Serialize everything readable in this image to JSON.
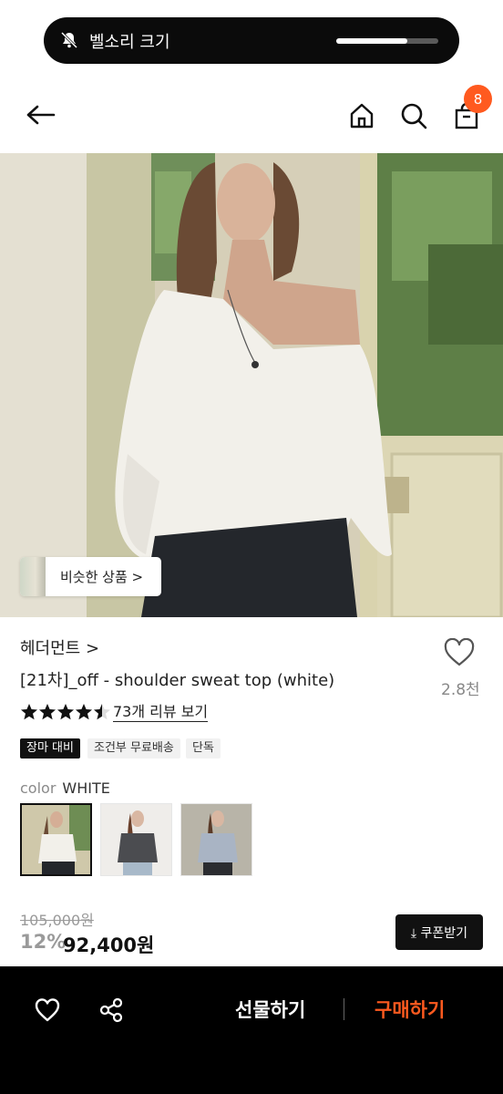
{
  "volume_toast": {
    "label": "벨소리 크기",
    "level": 0.7
  },
  "header": {
    "back_icon": "arrow-left-icon",
    "home_icon": "home-icon",
    "search_icon": "search-icon",
    "cart_icon": "shopping-bag-icon",
    "cart_count": "8"
  },
  "hero": {
    "similar_products_label": "비슷한 상품 >"
  },
  "product": {
    "brand": "헤더먼트 >",
    "title": "[21차]_off - shoulder sweat top (white)",
    "wishlist_count": "2.8천",
    "rating": 4.5,
    "review_link": "73개 리뷰 보기",
    "tags": [
      "장마 대비",
      "조건부 무료배송",
      "단독"
    ],
    "color_label": "color",
    "color_value": "WHITE",
    "original_price": "105,000원",
    "discount": "12%",
    "price": "92,400원",
    "coupon_label": "⤓ 쿠폰받기"
  },
  "bottom_bar": {
    "gift_label": "선물하기",
    "buy_label": "구매하기"
  },
  "colors": {
    "accent": "#ff5a1f",
    "dark": "#111111"
  }
}
